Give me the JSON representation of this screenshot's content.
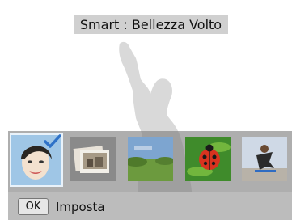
{
  "screen": {
    "title": "Smart : Bellezza Volto"
  },
  "modes": [
    {
      "name": "beauty-face",
      "selected": true
    },
    {
      "name": "frame-photo",
      "selected": false
    },
    {
      "name": "landscape",
      "selected": false
    },
    {
      "name": "macro-ladybug",
      "selected": false
    },
    {
      "name": "action-skate",
      "selected": false
    }
  ],
  "footer": {
    "ok_key": "OK",
    "ok_label": "Imposta"
  },
  "colors": {
    "accent": "#3a7bd5",
    "strip": "#7a7a7a",
    "footer": "#bcbcbc"
  }
}
